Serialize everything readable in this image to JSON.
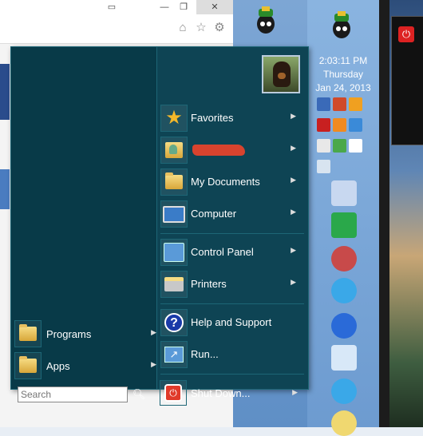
{
  "tray": {
    "time": "2:03:11 PM",
    "day": "Thursday",
    "date": "Jan 24, 2013"
  },
  "start_menu": {
    "right_items": [
      {
        "id": "favorites",
        "label": "Favorites",
        "icon": "star-icon",
        "has_submenu": true
      },
      {
        "id": "user",
        "label": "",
        "icon": "user-folder-icon",
        "has_submenu": true
      },
      {
        "id": "my-documents",
        "label": "My Documents",
        "icon": "folder-icon",
        "has_submenu": true
      },
      {
        "id": "computer",
        "label": "Computer",
        "icon": "computer-icon",
        "has_submenu": true
      },
      {
        "id": "control-panel",
        "label": "Control Panel",
        "icon": "control-panel-icon",
        "has_submenu": true
      },
      {
        "id": "printers",
        "label": "Printers",
        "icon": "printer-icon",
        "has_submenu": true
      },
      {
        "id": "help",
        "label": "Help and Support",
        "icon": "help-icon",
        "has_submenu": false
      },
      {
        "id": "run",
        "label": "Run...",
        "icon": "run-icon",
        "has_submenu": false
      },
      {
        "id": "shutdown",
        "label": "Shut Down...",
        "icon": "shutdown-icon",
        "has_submenu": true
      }
    ],
    "left_items": [
      {
        "id": "programs",
        "label": "Programs",
        "icon": "programs-folder-icon",
        "has_submenu": true
      },
      {
        "id": "apps",
        "label": "Apps",
        "icon": "apps-folder-icon",
        "has_submenu": true
      }
    ],
    "search": {
      "placeholder": "Search",
      "value": ""
    }
  },
  "colors": {
    "menu_background": "#0e4454",
    "menu_left_pane": "#083a48",
    "taskbar": "#7da6d4"
  }
}
